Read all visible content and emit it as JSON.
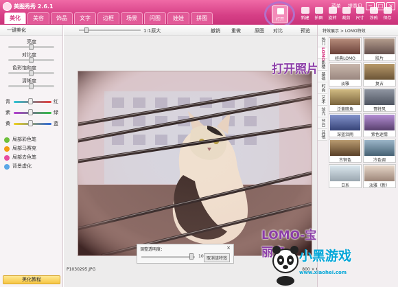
{
  "app": {
    "title": "美图秀秀 2.6.1",
    "links": [
      "菜单",
      "提意见"
    ],
    "window_buttons": [
      "−",
      "□",
      "×"
    ]
  },
  "tabs": [
    "美化",
    "美容",
    "饰品",
    "文字",
    "边框",
    "场景",
    "闪图",
    "娃娃",
    "拼图"
  ],
  "toolbar": {
    "open": "打开",
    "items": [
      "新建",
      "拍图",
      "旋转",
      "裁剪",
      "尺寸",
      "涂鸦",
      "保存"
    ]
  },
  "left_panel": {
    "auto_beautify": "一键美化",
    "sliders": [
      {
        "label": "亮度",
        "value": 0.5
      },
      {
        "label": "对比度",
        "value": 0.5
      },
      {
        "label": "色彩饱和度",
        "value": 0.5
      },
      {
        "label": "清晰度",
        "value": 0.5
      }
    ],
    "color_balance": [
      {
        "left": "青",
        "right": "红"
      },
      {
        "left": "紫",
        "right": "绿"
      },
      {
        "left": "黄",
        "right": "蓝"
      }
    ],
    "effects": [
      "局部彩色笔",
      "局部马赛克",
      "局部去色笔",
      "背景虚化"
    ],
    "tutorial": "美化教程"
  },
  "canvas_toolbar": {
    "zoom_label": "1:1原大",
    "undo": "撤销",
    "redo": "重做",
    "original": "原图",
    "compare": "对比",
    "preview": "预览"
  },
  "canvas": {
    "annotation_open": "打开照片",
    "annotation_effect": "LOMO-宝丽来",
    "file_name": "P1030295.JPG",
    "image_size": "800 × 600"
  },
  "adjust_dialog": {
    "label": "调整透明度：",
    "value": "100%",
    "cancel": "取消该特效",
    "close": "×",
    "opacity": 1.0
  },
  "right_panel": {
    "breadcrumb": "特效展示 > LOMO特效",
    "side_tabs": [
      "热门",
      "LOMO",
      "影楼",
      "基础",
      "时尚",
      "艺术",
      "炫光",
      "节日",
      "其他"
    ],
    "presets": [
      "经典LOMO",
      "胶片",
      "淡雅",
      "复古",
      "泛黄暗角",
      "哥特风",
      "深蓝泪雨",
      "紫色迷情",
      "古铜色",
      "冷色调",
      "日系",
      "淡雅（新）"
    ]
  },
  "watermark": {
    "logo": "小黑游戏",
    "url": "www.xiaohei.com"
  },
  "colors": {
    "brand": "#d63f86",
    "annotation": "#8c3ea8",
    "watermark": "#00a6d8"
  }
}
